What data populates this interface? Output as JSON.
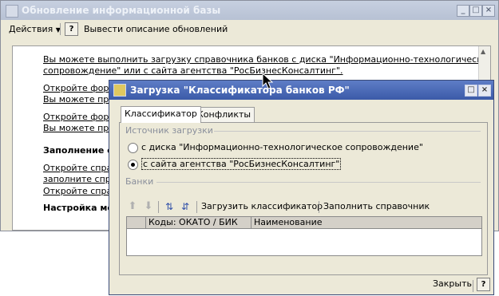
{
  "back_window": {
    "title": "Обновление информационной базы",
    "toolbar": {
      "actions_label": "Действия",
      "help_label": "?",
      "output_label": "Вывести описание обновлений"
    },
    "content": {
      "line1a": "Вы можете выполнить загрузку справочника банков с диска \"Информационно-технологическое",
      "line1b": "сопровождение\" или с сайта агентства \"РосБизнесКонсалтинг\".",
      "line2": "Откройте форму",
      "line3": "Вы можете прос",
      "line4": "Откройте форму",
      "line5": "Вы можете прос",
      "line6": "Заполнение сп",
      "line7": "Откройте справо",
      "line8": "заполните справ",
      "line9": "Откройте справо",
      "line10": "Настройка меха"
    }
  },
  "dialog": {
    "title": "Загрузка \"Классификатора банков РФ\"",
    "tabs": [
      "Классификатор",
      "Конфликты"
    ],
    "source_group": "Источник загрузки",
    "radio_disk": "с диска \"Информационно-технологическое сопровождение\"",
    "radio_site": "с сайта агентства \"РосБизнесКонсалтинг\"",
    "radio_selected": "site",
    "banks_group": "Банки",
    "load_button": "Загрузить классификатор",
    "fill_button": "Заполнить справочник",
    "columns": [
      "Коды: ОКАТО / БИК",
      "Наименование"
    ],
    "close_label": "Закрыть",
    "help_label": "?"
  }
}
